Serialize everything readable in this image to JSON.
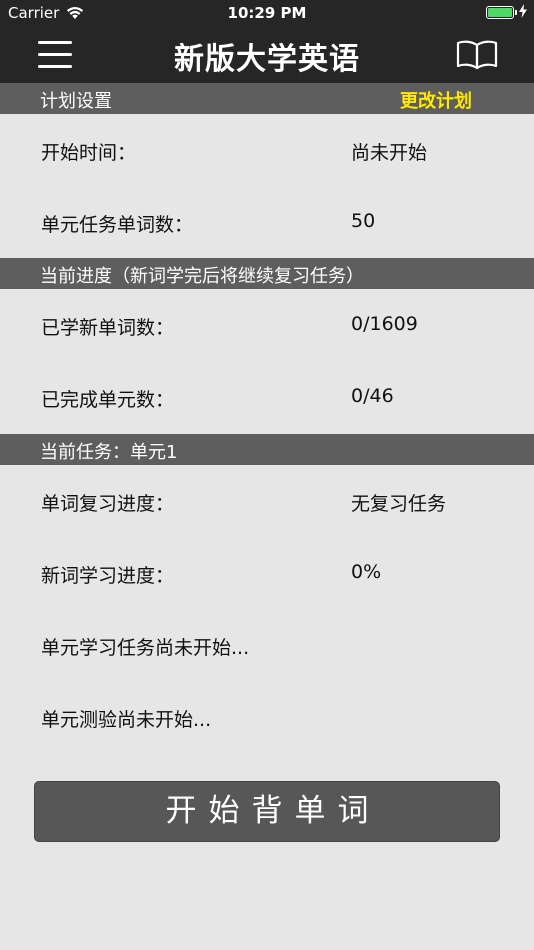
{
  "status_bar": {
    "carrier": "Carrier",
    "time": "10:29 PM"
  },
  "nav": {
    "title": "新版大学英语"
  },
  "plan_section": {
    "title": "计划设置",
    "action": "更改计划",
    "rows": [
      {
        "label": "开始时间：",
        "value": "尚未开始"
      },
      {
        "label": "单元任务单词数：",
        "value": "50"
      }
    ]
  },
  "progress_section": {
    "title": "当前进度（新词学完后将继续复习任务）",
    "rows": [
      {
        "label": "已学新单词数：",
        "value": "0/1609"
      },
      {
        "label": "已完成单元数：",
        "value": "0/46"
      }
    ]
  },
  "task_section": {
    "title": "当前任务：单元1",
    "rows": [
      {
        "label": "单词复习进度：",
        "value": "无复习任务"
      },
      {
        "label": "新词学习进度：",
        "value": "0%"
      }
    ],
    "notes": [
      "单元学习任务尚未开始...",
      "单元测验尚未开始..."
    ]
  },
  "start_button": "开始背单词",
  "colors": {
    "bar": "#262626",
    "section": "#5e5e5e",
    "accent": "#ffea00",
    "background": "#e6e6e6",
    "battery": "#4cd964"
  }
}
